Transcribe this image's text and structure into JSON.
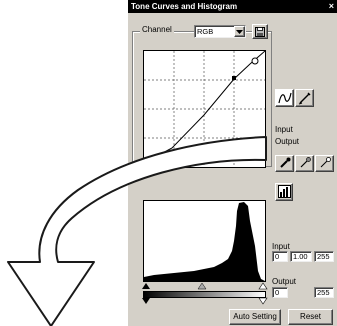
{
  "window": {
    "title": "Tone Curves and Histogram",
    "close_glyph": "×"
  },
  "channel": {
    "label": "Channel",
    "value": "RGB"
  },
  "curve_panel": {
    "input_label": "Input",
    "output_label": "Output"
  },
  "histogram_panel": {
    "input_label": "Input",
    "input_values": [
      "0",
      "1.00",
      "255"
    ],
    "output_label": "Output",
    "output_values": [
      "0",
      "255"
    ]
  },
  "buttons": {
    "auto_setting": "Auto Setting",
    "reset": "Reset"
  },
  "icons": {
    "save_curve": "floppy-icon",
    "curve_mode": "curve-freehand-icon",
    "line_mode": "line-pencil-icon",
    "eyedroppers": [
      "black-point-eyedropper-icon",
      "gray-point-eyedropper-icon",
      "white-point-eyedropper-icon"
    ],
    "hist_tool": "histogram-icon"
  },
  "colors": {
    "accent": "#000000",
    "panel": "#d4d0c8",
    "arrow_fill": "#ffffff",
    "arrow_stroke": "#1a1a1a"
  }
}
